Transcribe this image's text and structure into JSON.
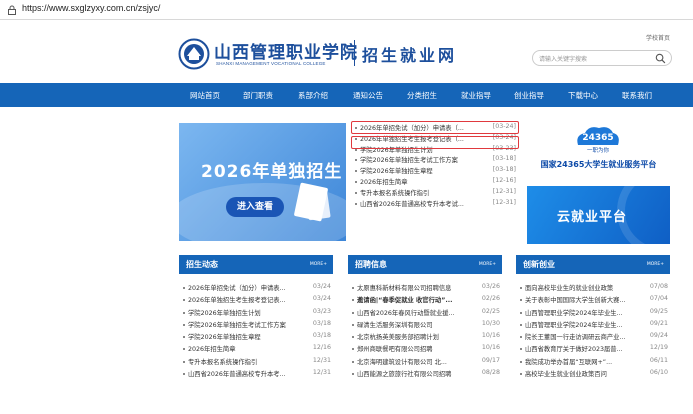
{
  "browser": {
    "url": "https://www.sxglzyxy.com.cn/zsjyc/"
  },
  "header": {
    "top_link": "学校首页",
    "school_name": "山西管理职业学院",
    "school_name_en": "SHANXI MANAGEMENT VOCATIONAL COLLEGE",
    "site_name": "招生就业网",
    "search_placeholder": "请输入关键字搜索"
  },
  "nav": [
    "网站首页",
    "部门职责",
    "系部介绍",
    "通知公告",
    "分类招生",
    "就业指导",
    "创业指导",
    "下载中心",
    "联系我们"
  ],
  "banner": {
    "title": "2026年单独招生",
    "button": "进入查看"
  },
  "news": [
    {
      "title": "2026年单招免试（加分）申请表（...",
      "date": "[03-24]"
    },
    {
      "title": "2026年单独招生考生报考登记表（...",
      "date": "[03-24]"
    },
    {
      "title": "学院2026年单独招生计划",
      "date": "[03-23]"
    },
    {
      "title": "学院2026年单独招生考试工作方案",
      "date": "[03-18]"
    },
    {
      "title": "学院2026年单独招生章程",
      "date": "[03-18]"
    },
    {
      "title": "2026年招生简章",
      "date": "[12-16]"
    },
    {
      "title": "专升本报名系统操作指引",
      "date": "[12-31]"
    },
    {
      "title": "山西省2026年普通高校专升本考试...",
      "date": "[12-31]"
    }
  ],
  "right_promos": {
    "badge_number": "24365",
    "badge_sub": "一职为你",
    "caption": "国家24365大学生就业服务平台",
    "cloud": "云就业平台"
  },
  "columns": [
    {
      "title": "招生动态",
      "more": "MORE+",
      "items": [
        {
          "title": "2026年单招免试（加分）申请表...",
          "date": "03/24",
          "bold": false
        },
        {
          "title": "2026年单独招生考生报考登记表...",
          "date": "03/24",
          "bold": false
        },
        {
          "title": "学院2026年单独招生计划",
          "date": "03/23",
          "bold": false
        },
        {
          "title": "学院2026年单独招生考试工作方案",
          "date": "03/18",
          "bold": false
        },
        {
          "title": "学院2026年单独招生章程",
          "date": "03/18",
          "bold": false
        },
        {
          "title": "2026年招生简章",
          "date": "12/16",
          "bold": false
        },
        {
          "title": "专升本报名系统操作指引",
          "date": "12/31",
          "bold": false
        },
        {
          "title": "山西省2026年普通高校专升本考...",
          "date": "12/31",
          "bold": false
        }
      ]
    },
    {
      "title": "招聘信息",
      "more": "MORE+",
      "items": [
        {
          "title": "太原惠科新材料有限公司招聘信息",
          "date": "03/26",
          "bold": false
        },
        {
          "title": "邀请函|“春季促就业 收官行动”...",
          "date": "02/26",
          "bold": true
        },
        {
          "title": "山西省2026年春风行动暨就业援...",
          "date": "02/25",
          "bold": false
        },
        {
          "title": "碌清生活服务深圳有限公司",
          "date": "10/30",
          "bold": false
        },
        {
          "title": "北京杭扬英美服务部招聘计划",
          "date": "10/16",
          "bold": false
        },
        {
          "title": "郑州商联餐吧有限公司招聘",
          "date": "10/16",
          "bold": false
        },
        {
          "title": "北京海明建筑设计有限公司 北...",
          "date": "09/17",
          "bold": false
        },
        {
          "title": "山西能源之旅旅行社有限公司招聘",
          "date": "08/28",
          "bold": false
        }
      ]
    },
    {
      "title": "创新创业",
      "more": "MORE+",
      "items": [
        {
          "title": "面向高校毕业生的就业创业政策",
          "date": "07/08",
          "bold": false
        },
        {
          "title": "关于表彰中国国际大学生创新大赛...",
          "date": "07/04",
          "bold": false
        },
        {
          "title": "山西管理职业学院2024年毕业生...",
          "date": "09/25",
          "bold": false
        },
        {
          "title": "山西管理职业学院2024年毕业生...",
          "date": "09/21",
          "bold": false
        },
        {
          "title": "院长王董国一行走访调研云商产业...",
          "date": "09/24",
          "bold": false
        },
        {
          "title": "山西省教育厅关于做好2023届普...",
          "date": "12/19",
          "bold": false
        },
        {
          "title": "我院成功举办首届“互联网+”...",
          "date": "06/11",
          "bold": false
        },
        {
          "title": "高校毕业生就业创业政策百问",
          "date": "06/10",
          "bold": false
        }
      ]
    }
  ],
  "colors": {
    "nav_blue": "#1565b8",
    "brand_blue": "#1d4f9c",
    "highlight_red": "#e0393e"
  }
}
